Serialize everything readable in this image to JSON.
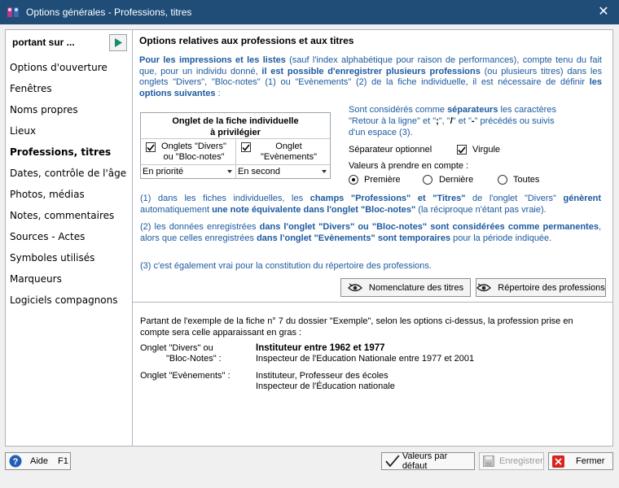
{
  "window": {
    "title": "Options générales - Professions, titres",
    "close_glyph": "✕"
  },
  "sidebar": {
    "header": "portant sur ...",
    "items": [
      {
        "label": "Options d'ouverture",
        "active": false
      },
      {
        "label": "Fenêtres",
        "active": false
      },
      {
        "label": "Noms propres",
        "active": false
      },
      {
        "label": "Lieux",
        "active": false
      },
      {
        "label": "Professions, titres",
        "active": true
      },
      {
        "label": "Dates, contrôle de l'âge",
        "active": false
      },
      {
        "label": "Photos, médias",
        "active": false
      },
      {
        "label": "Notes, commentaires",
        "active": false
      },
      {
        "label": "Sources - Actes",
        "active": false
      },
      {
        "label": "Symboles utilisés",
        "active": false
      },
      {
        "label": "Marqueurs",
        "active": false
      },
      {
        "label": "Logiciels compagnons",
        "active": false
      }
    ]
  },
  "main": {
    "title": "Options relatives aux professions et aux titres",
    "intro": {
      "p1_bold": "Pour les impressions et les listes",
      "p1_rest": " (sauf l'index alphabétique pour raison de performances), compte tenu du fait que, pour un individu donné, ",
      "p2_bold": "il est possible d'enregistrer plusieurs professions",
      "p2_rest": " (ou plusieurs titres) dans les onglets \"Divers\", \"Bloc-notes\" (1) ou \"Evènements\" (2) de la fiche individuelle, il est nécessaire de définir ",
      "p3_bold": "les options suivantes",
      "p3_rest": " :"
    },
    "onglet": {
      "header_line1": "Onglet de la fiche individuelle",
      "header_line2": "à privilégier",
      "col1_line1": "Onglets  \"Divers\"",
      "col1_line2": "ou \"Bloc-notes\"",
      "col2_line1": "Onglet",
      "col2_line2": "\"Evènements\"",
      "select1": "En priorité",
      "select2": "En second"
    },
    "separators": {
      "t1": "Sont considérés comme ",
      "t1_bold": "séparateurs",
      "t2": " les caractères",
      "t3": "\"Retour à la ligne\" et \"",
      "s1": ";",
      "t4": "\", \"",
      "s2": "/",
      "t5": "\" et \"",
      "s3": "-",
      "t6": "\" précédés ou suivis",
      "t7": "d'un espace (3).",
      "optional_label": "Séparateur optionnel",
      "comma_label": "Virgule",
      "values_label": "Valeurs à prendre en compte :",
      "radio_first": "Première",
      "radio_last": "Dernière",
      "radio_all": "Toutes"
    },
    "notes": {
      "n1_a": "(1) dans les fiches individuelles, les ",
      "n1_b": "champs \"Professions\" et \"Titres\"",
      "n1_c": " de l'onglet \"Divers\" ",
      "n1_d": "génèrent",
      "n1_e": " automatiquement ",
      "n1_f": "une note équivalente dans l'onglet \"Bloc-notes\"",
      "n1_g": " (la réciproque n'étant pas vraie).",
      "n2_a": "(2) les données enregistrées ",
      "n2_b": "dans l'onglet \"Divers\" ou \"Bloc-notes\" sont considérées comme permanentes",
      "n2_c": ", alors que celles enregistrées ",
      "n2_d": "dans l'onglet \"Evènements\" sont temporaires",
      "n2_e": " pour la période indiquée.",
      "n3": "(3) c'est également vrai pour la constitution du répertoire des professions."
    },
    "buttons": {
      "nomenclature": "Nomenclature des titres",
      "repertoire": "Répertoire des professions"
    },
    "example": {
      "intro": "Partant de l'exemple de la fiche n° 7 du dossier \"Exemple\", selon les options ci-dessus, la profession prise en compte sera celle apparaissant en gras :",
      "label1_l1": "Onglet \"Divers\" ou",
      "label1_l2": "\"Bloc-Notes\" :",
      "val1_l1": "Instituteur entre 1962 et 1977",
      "val1_l2": "Inspecteur de l'Education Nationale entre 1977 et 2001",
      "label2": "Onglet \"Evènements\" :",
      "val2_l1": "Instituteur, Professeur des écoles",
      "val2_l2": "Inspecteur de l'Éducation nationale"
    }
  },
  "footer": {
    "help_label": "Aide",
    "help_key": "F1",
    "defaults_label": "Valeurs par défaut",
    "save_label": "Enregistrer",
    "close_label": "Fermer"
  },
  "colors": {
    "accent_blue": "#1c5aa0",
    "titlebar": "#1f4d78",
    "close_red": "#d9241c"
  }
}
